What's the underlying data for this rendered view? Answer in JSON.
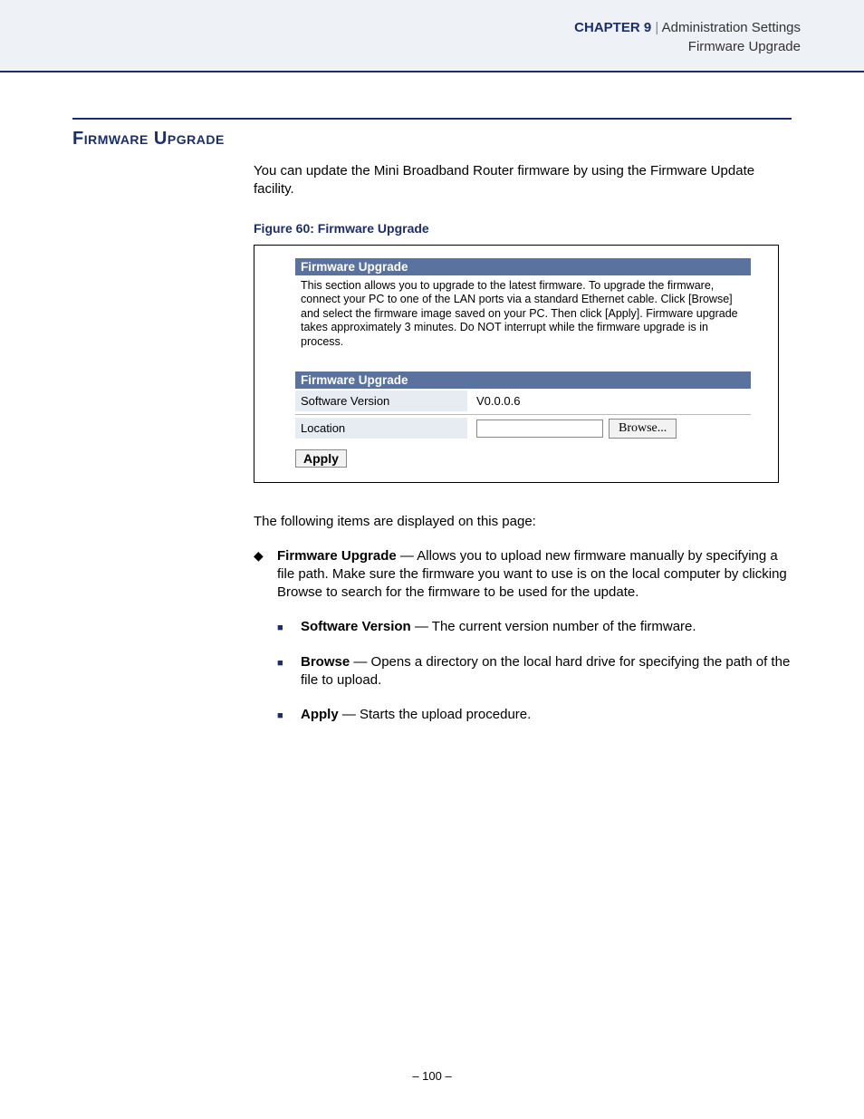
{
  "header": {
    "chapter": "CHAPTER 9",
    "separator": "|",
    "subject": "Administration Settings",
    "sub": "Firmware Upgrade"
  },
  "section": {
    "heading": "Firmware Upgrade",
    "intro": "You can update the Mini Broadband Router firmware by using the Firmware Update facility."
  },
  "figure": {
    "caption": "Figure 60:  Firmware Upgrade",
    "panel1_header": "Firmware Upgrade",
    "panel1_desc": "This section allows you to upgrade to the latest firmware. To upgrade the firmware, connect your PC to one of the LAN ports via a standard Ethernet cable. Click [Browse] and select the firmware image saved on your PC. Then click [Apply]. Firmware upgrade takes approximately 3 minutes. Do NOT interrupt while the firmware upgrade is in process.",
    "panel2_header": "Firmware Upgrade",
    "row1_label": "Software Version",
    "row1_value": "V0.0.0.6",
    "row2_label": "Location",
    "browse_label": "Browse...",
    "apply_label": "Apply"
  },
  "following": "The following items are displayed on this page:",
  "bullets": {
    "b1_term": "Firmware Upgrade",
    "b1_text": " — Allows you to upload new firmware manually by specifying a file path. Make sure the firmware you want to use is on the local computer by clicking Browse to search for the firmware to be used for the update.",
    "s1_term": "Software Version",
    "s1_text": " — The current version number of the firmware.",
    "s2_term": "Browse",
    "s2_text": " — Opens a directory on the local hard drive for specifying the path of the file to upload.",
    "s3_term": "Apply",
    "s3_text": " — Starts the upload procedure."
  },
  "footer": {
    "page": "–  100  –"
  }
}
